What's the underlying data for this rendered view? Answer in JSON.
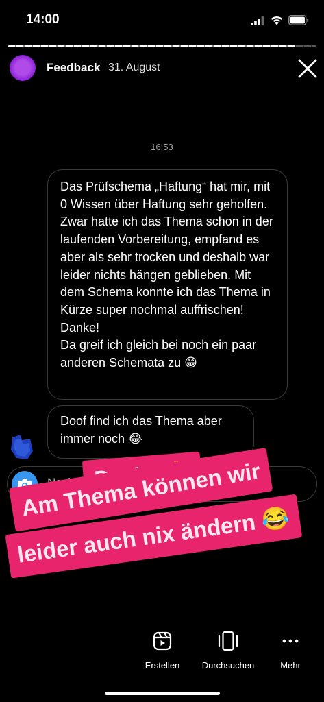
{
  "status_bar": {
    "time": "14:00"
  },
  "story": {
    "progress_fraction": 0.93,
    "account_name": "Feedback",
    "date": "31. August"
  },
  "chat": {
    "timestamp": "16:53",
    "messages": [
      {
        "text": "Das Prüfschema „Haftung“ hat mir, mit 0 Wissen über Haftung sehr geholfen. Zwar hatte ich das Thema schon in der laufenden Vorbereitung, empfand es aber als sehr trocken und deshalb war leider nichts hängen geblieben. Mit dem Schema konnte ich das Thema in Kürze super nochmal auffrischen! Danke!\nDa greif ich gleich bei noch ein paar anderen Schemata zu 😁"
      },
      {
        "text": "Doof find ich das Thema aber immer noch 😂"
      }
    ],
    "reply_placeholder": "Nachricht"
  },
  "overlay": {
    "line1": "Danke 🙏",
    "line2": "Am Thema können wir",
    "line3": "leider auch nix ändern 😂",
    "color": "#e8246c"
  },
  "bottom_nav": {
    "create_label": "Erstellen",
    "browse_label": "Durchsuchen",
    "more_label": "Mehr"
  },
  "colors": {
    "background": "#000000",
    "accent_blue": "#3797f0",
    "avatar_purple": "#8b1fd6"
  }
}
